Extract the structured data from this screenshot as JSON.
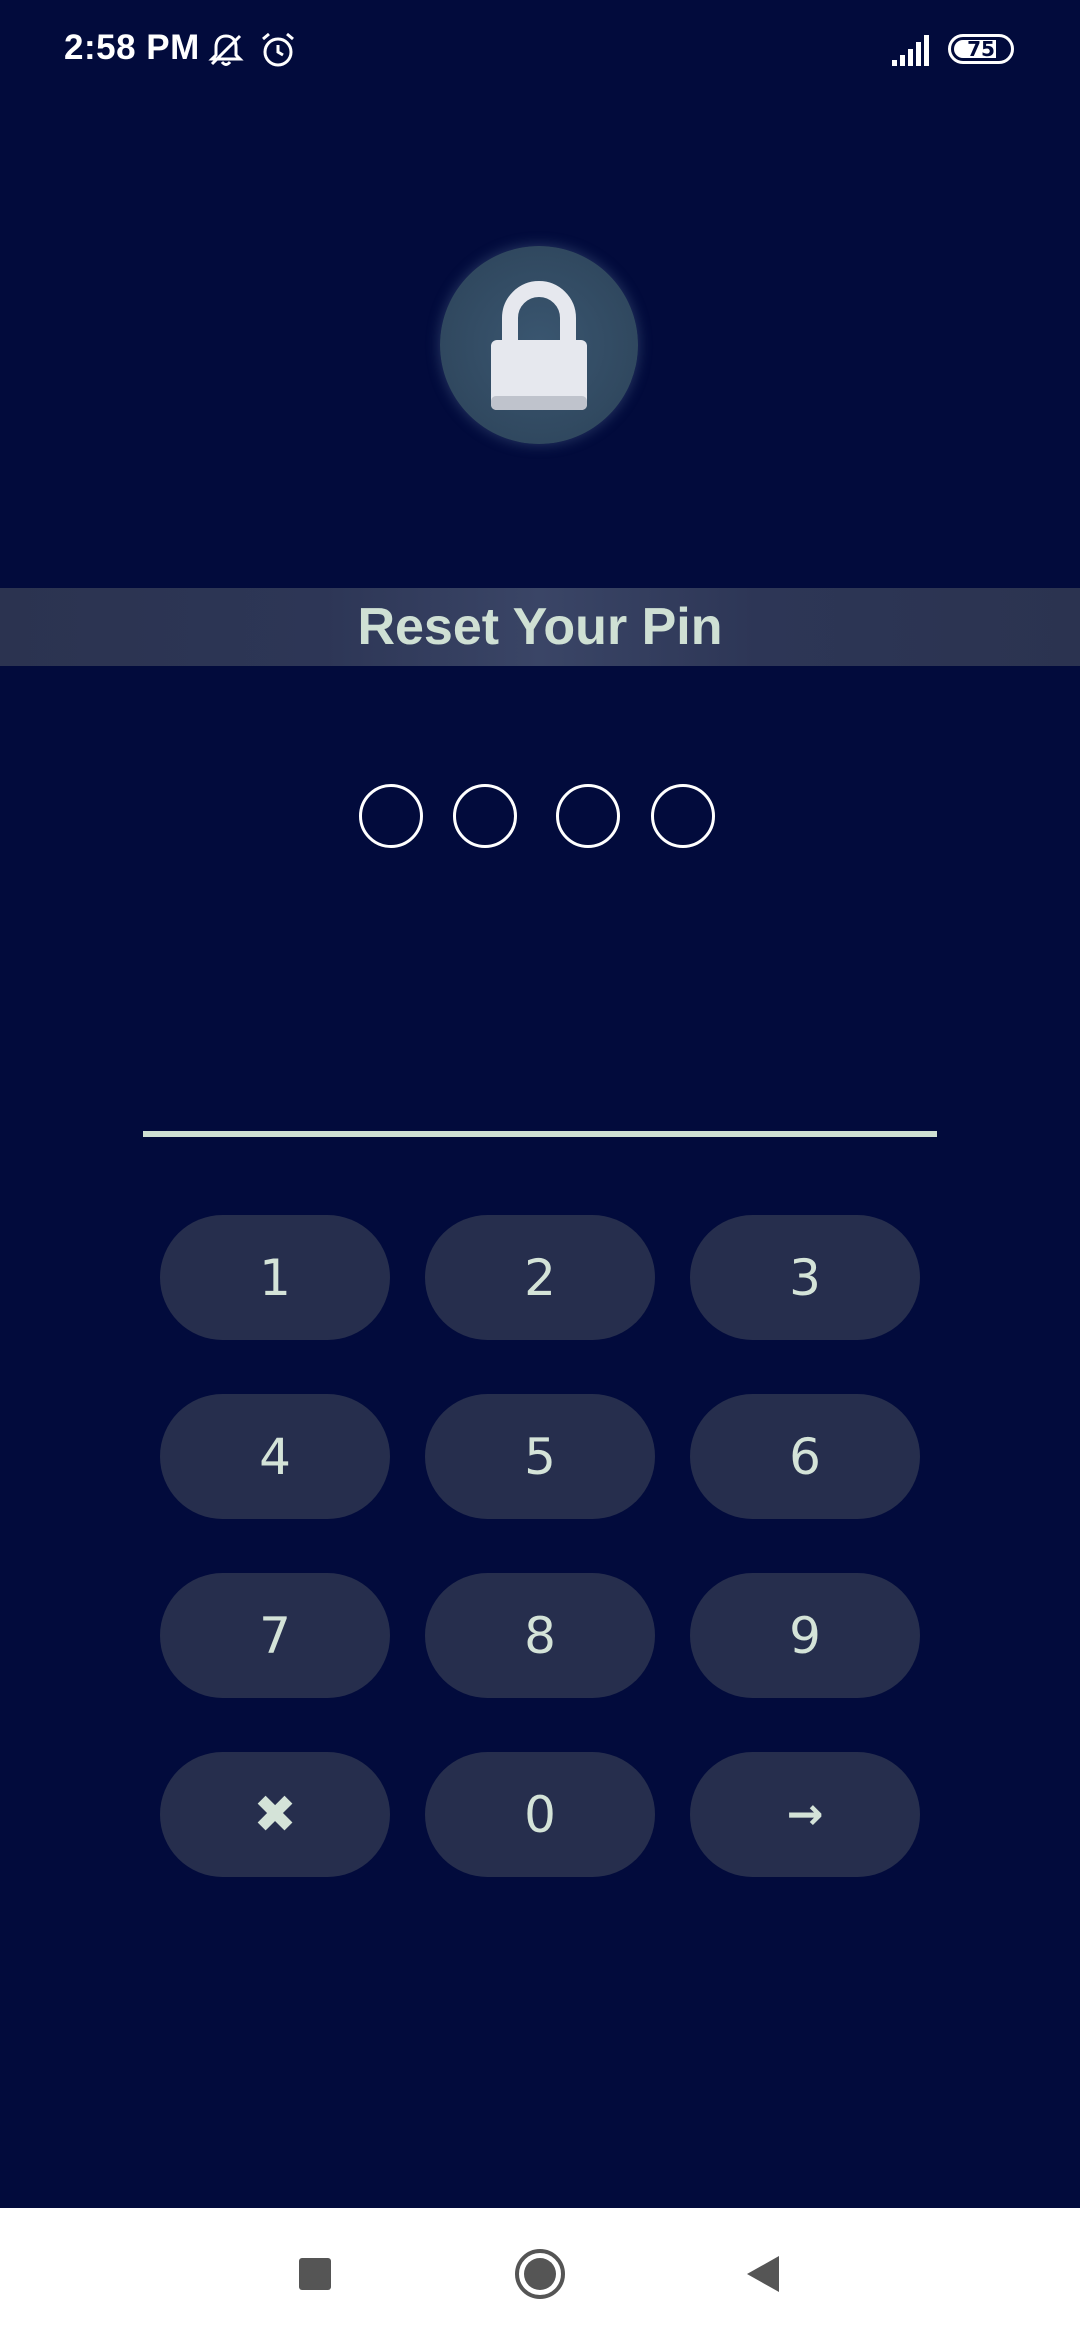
{
  "status_bar": {
    "time": "2:58 PM",
    "battery_level": "75",
    "icons": [
      "notifications-muted-icon",
      "alarm-icon",
      "signal-icon",
      "battery-icon"
    ]
  },
  "lock": {
    "icon": "padlock-icon"
  },
  "title": "Reset Your Pin",
  "pin": {
    "length": 4,
    "entered": 0
  },
  "keypad": {
    "keys": [
      "1",
      "2",
      "3",
      "4",
      "5",
      "6",
      "7",
      "8",
      "9",
      "✖",
      "0",
      "→"
    ]
  },
  "nav_bar": {
    "icons": [
      "recents-square-icon",
      "home-circle-icon",
      "back-triangle-icon"
    ]
  },
  "colors": {
    "background": "#020b3c",
    "key_background": "#262e4d",
    "key_text": "#d4e3d8",
    "title_text": "#cfe0d4"
  }
}
